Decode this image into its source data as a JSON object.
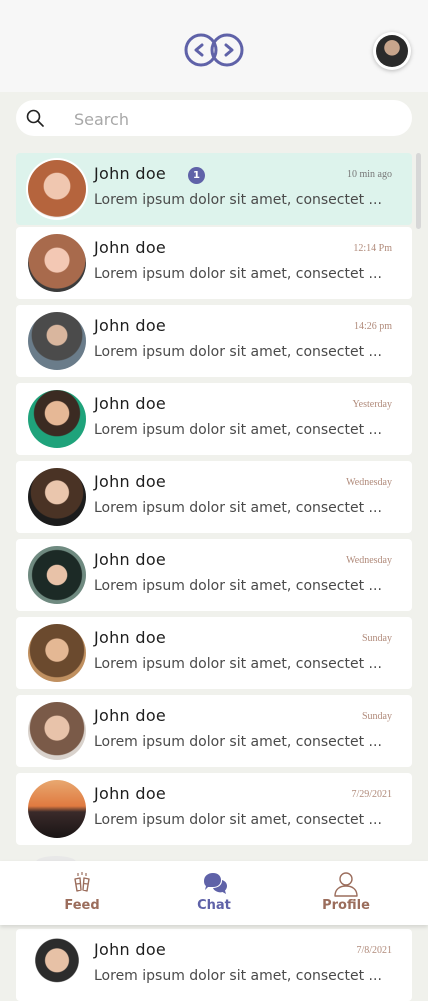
{
  "header": {
    "logo_icon": "linked-rings-logo-icon",
    "profile_avatar_icon": "user-avatar"
  },
  "search": {
    "placeholder": "Search",
    "value": ""
  },
  "colors": {
    "accent": "#5f62a8",
    "active_row": "#ddf3ec",
    "nav_inactive": "#9b6d5c",
    "timestamp": "#b08a7a"
  },
  "chats": [
    {
      "name": "John doe",
      "message": "Lorem ipsum dolor sit amet, consectet ...",
      "time": "10 min ago",
      "unread": "1",
      "active": true
    },
    {
      "name": "John doe",
      "message": "Lorem ipsum dolor sit amet, consectet ...",
      "time": "12:14 Pm"
    },
    {
      "name": "John doe",
      "message": "Lorem ipsum dolor sit amet, consectet ...",
      "time": "14:26 pm"
    },
    {
      "name": "John doe",
      "message": "Lorem ipsum dolor sit amet, consectet ...",
      "time": "Yesterday"
    },
    {
      "name": "John doe",
      "message": "Lorem ipsum dolor sit amet, consectet ...",
      "time": "Wednesday"
    },
    {
      "name": "John doe",
      "message": "Lorem ipsum dolor sit amet, consectet ...",
      "time": "Wednesday"
    },
    {
      "name": "John doe",
      "message": "Lorem ipsum dolor sit amet, consectet ...",
      "time": "Sunday"
    },
    {
      "name": "John doe",
      "message": "Lorem ipsum dolor sit amet, consectet ...",
      "time": "Sunday"
    },
    {
      "name": "John doe",
      "message": "Lorem ipsum dolor sit amet, consectet ...",
      "time": "7/29/2021"
    },
    {
      "name": "John doe",
      "message": "Lorem ipsum dolor sit amet, consectet ...",
      "time": "7/8/2021"
    }
  ],
  "nav": {
    "feed_label": "Feed",
    "chat_label": "Chat",
    "profile_label": "Profile",
    "active": "chat"
  }
}
